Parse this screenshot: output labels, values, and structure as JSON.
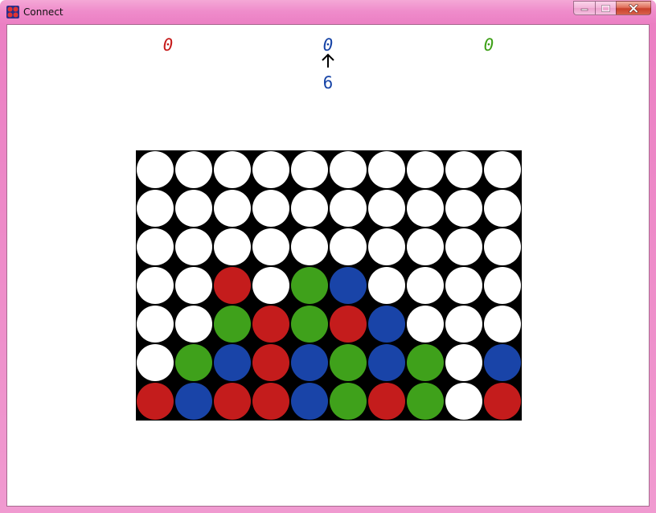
{
  "window": {
    "title": "Connect",
    "buttons": [
      "minimize",
      "maximize",
      "close"
    ]
  },
  "scores": [
    {
      "player": "red",
      "value": "0",
      "color": "#c61b1b"
    },
    {
      "player": "blue",
      "value": "0",
      "color": "#1744a6"
    },
    {
      "player": "green",
      "value": "0",
      "color": "#3ea018"
    }
  ],
  "current_turn": "blue",
  "turn_indicator": "up-arrow-icon",
  "move_counter": "6",
  "colors": {
    "empty": "#ffffff",
    "red": "#c41c1c",
    "blue": "#1944a8",
    "green": "#3fa11b",
    "board": "#000000"
  },
  "board": {
    "columns": 10,
    "rows": 7,
    "cells": [
      [
        "E",
        "E",
        "E",
        "E",
        "E",
        "E",
        "E",
        "E",
        "E",
        "E"
      ],
      [
        "E",
        "E",
        "E",
        "E",
        "E",
        "E",
        "E",
        "E",
        "E",
        "E"
      ],
      [
        "E",
        "E",
        "E",
        "E",
        "E",
        "E",
        "E",
        "E",
        "E",
        "E"
      ],
      [
        "E",
        "E",
        "R",
        "E",
        "G",
        "B",
        "E",
        "E",
        "E",
        "E"
      ],
      [
        "E",
        "E",
        "G",
        "R",
        "G",
        "R",
        "B",
        "E",
        "E",
        "E"
      ],
      [
        "E",
        "G",
        "B",
        "R",
        "B",
        "G",
        "B",
        "G",
        "E",
        "B"
      ],
      [
        "R",
        "B",
        "R",
        "R",
        "B",
        "G",
        "R",
        "G",
        "E",
        "R"
      ]
    ]
  }
}
